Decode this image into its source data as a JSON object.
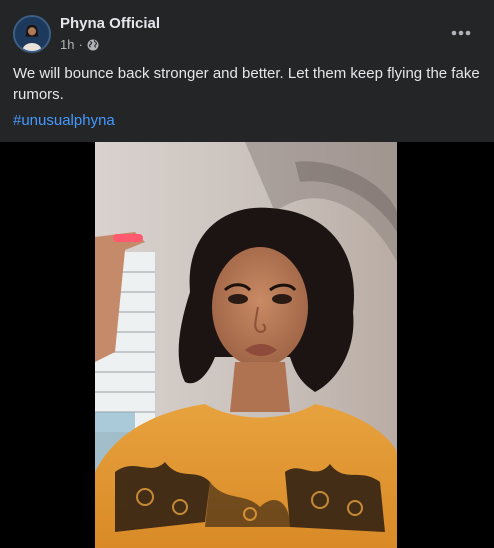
{
  "post": {
    "author": "Phyna Official",
    "time": "1h",
    "separator": "·",
    "privacy_icon": "globe-icon",
    "more_icon": "more-horizontal-icon",
    "text": "We will bounce back stronger and better. Let them keep flying the fake rumors.",
    "hashtag": "#unusualphyna"
  },
  "media": {
    "type": "video",
    "content": "woman-with-bob-wig-in-orange-lace-top"
  },
  "colors": {
    "card_background": "#242526",
    "page_background": "#000000",
    "primary_text": "#e4e6eb",
    "secondary_text": "#b0b3b8",
    "link": "#4599ff"
  }
}
